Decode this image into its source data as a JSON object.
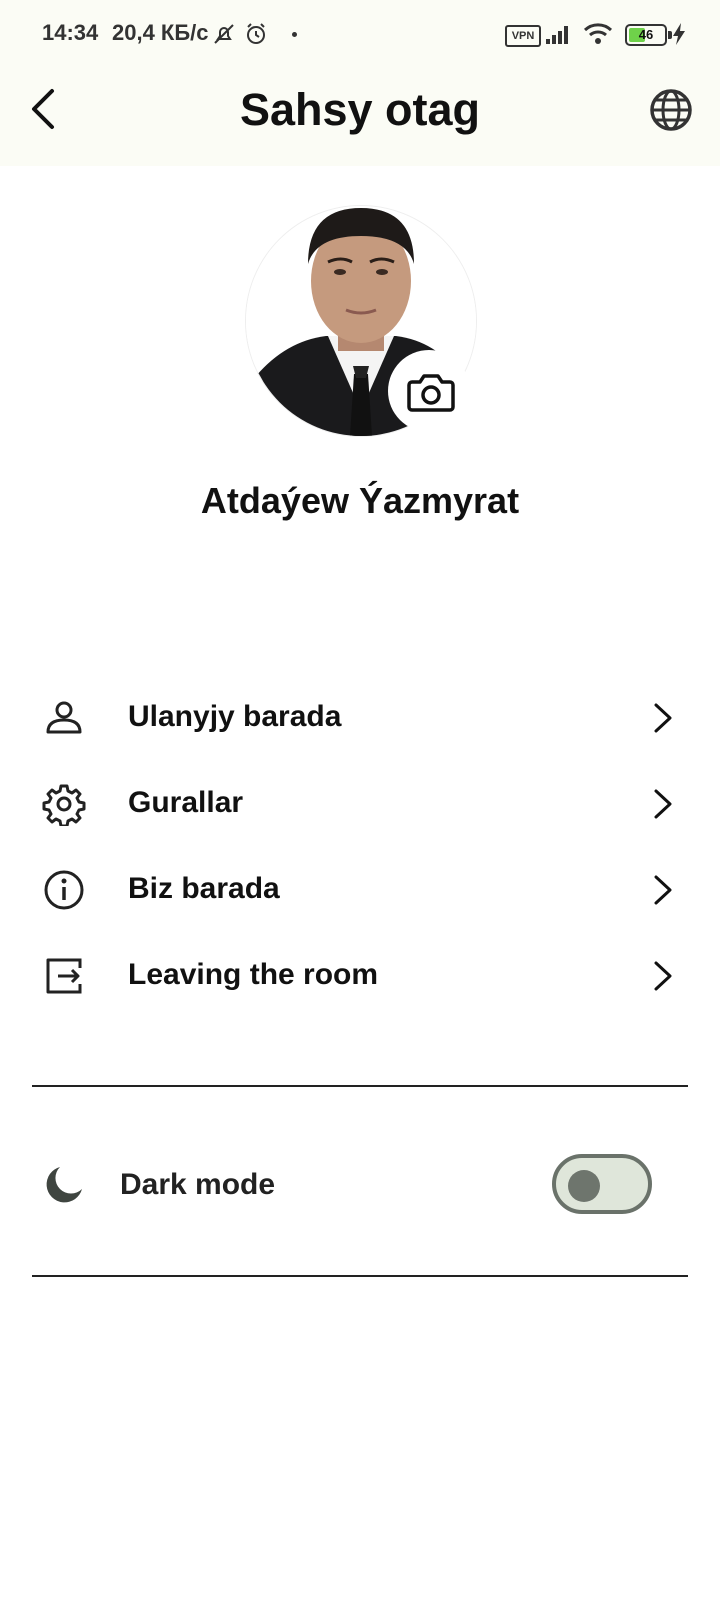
{
  "status_bar": {
    "time": "14:34",
    "speed": "20,4 КБ/с",
    "vpn": "VPN",
    "battery": "46",
    "battery_level_percent": 46,
    "battery_color": "#6fd24a",
    "icons": [
      "mute-icon",
      "alarm-icon",
      "signal-icon",
      "wifi-icon",
      "charging-icon"
    ]
  },
  "header": {
    "title": "Sahsy otag",
    "back_icon": "chevron-left-icon",
    "language_icon": "globe-icon"
  },
  "profile": {
    "name": "Atdaýew Ýazmyrat",
    "avatar": "profile-photo",
    "camera_icon": "camera-icon"
  },
  "menu": {
    "items": [
      {
        "label": "Ulanyjy barada",
        "icon": "user-icon"
      },
      {
        "label": "Gurallar",
        "icon": "gear-icon"
      },
      {
        "label": "Biz barada",
        "icon": "info-icon"
      },
      {
        "label": "Leaving the room",
        "icon": "logout-icon"
      }
    ]
  },
  "settings": {
    "dark_mode_label": "Dark mode",
    "dark_mode_on": false,
    "toggle_track_color": "#dfe6da",
    "toggle_knob_color": "#6e756d"
  }
}
